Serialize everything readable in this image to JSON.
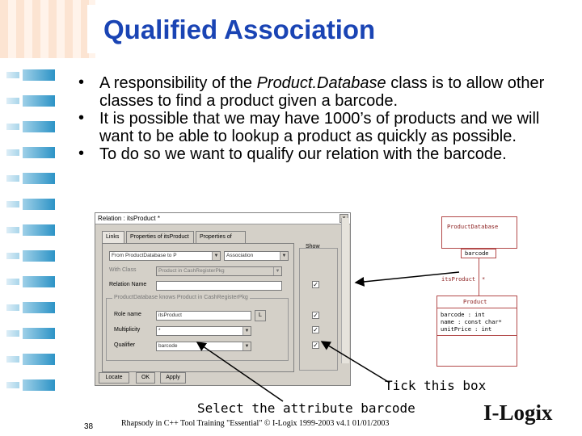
{
  "slide": {
    "title": "Qualified Association",
    "bullets": [
      {
        "pre": "A responsibility of the ",
        "italic": "Product.Database",
        "post": " class is to allow other classes to find a product given a barcode."
      },
      {
        "pre": "It is possible that we may have 1000’s of products and we will want to be able to lookup a product as quickly as possible.",
        "italic": "",
        "post": ""
      },
      {
        "pre": "To do so we want to qualify our relation with the barcode.",
        "italic": "",
        "post": ""
      }
    ],
    "annotation_tick": "Tick this box",
    "annotation_select": "Select the attribute barcode",
    "slide_number": "38",
    "footer": "Rhapsody in C++ Tool Training \"Essential\"  © I-Logix 1999-2003   v4.1  01/01/2003",
    "logo_text": "I-Logix"
  },
  "dialog": {
    "title": "Relation : itsProduct *",
    "close_label": "×",
    "tabs": [
      "Links",
      "Properties of itsProduct",
      "Properties of"
    ],
    "show_label": "Show",
    "from_value": "From ProductDatabase to P",
    "type_value": "Association",
    "with_class_label": "With Class",
    "with_class_value": "Product in CashRegisterPkg",
    "relation_name_label": "Relation Name",
    "group_caption": "ProductDatabase knows Product in CashRegisterPkg",
    "role_name_label": "Role name",
    "role_name_value": "itsProduct",
    "multiplicity_label": "Multiplicity",
    "multiplicity_value": "*",
    "qualifier_label": "Qualifier",
    "qualifier_value": "barcode",
    "buttons": {
      "locate": "Locate",
      "ok": "OK",
      "apply": "Apply"
    },
    "l_button": "L",
    "check": "✓"
  },
  "uml": {
    "class1_name": "ProductDatabase",
    "qualifier": "barcode",
    "role": "itsProduct",
    "role_mult": "*",
    "class2_name": "Product",
    "attributes": [
      "barcode : int",
      "name : const char*",
      "unitPrice : int"
    ]
  }
}
